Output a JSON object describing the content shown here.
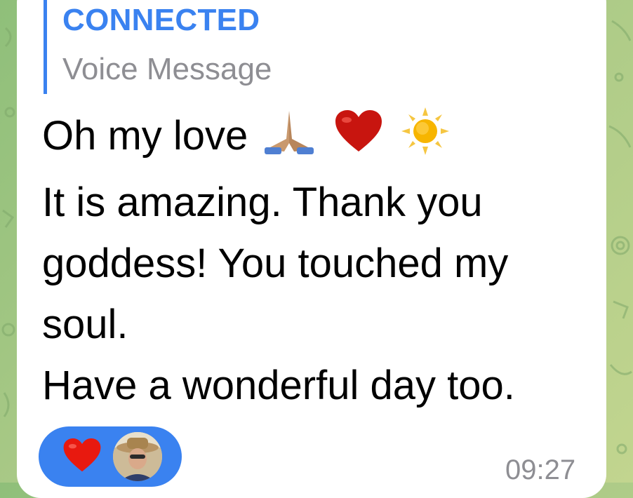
{
  "reply": {
    "name": "CONNECTED",
    "preview": "Voice Message"
  },
  "message": {
    "line1": "Oh my love",
    "line1_emojis": [
      "folded-hands",
      "red-heart",
      "sun"
    ],
    "line2": "It is amazing. Thank you",
    "line3": "goddess! You touched my",
    "line4": "soul.",
    "line5": "Have a wonderful day too."
  },
  "reaction": {
    "emoji": "red-heart",
    "color": "#3a82f0"
  },
  "time": "09:27"
}
